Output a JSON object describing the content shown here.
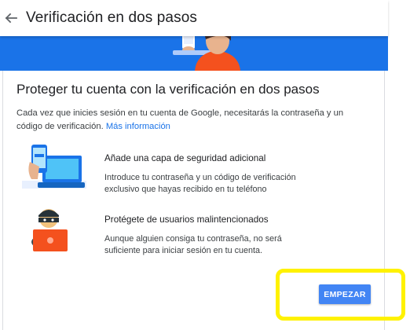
{
  "header": {
    "back_icon": "arrow-left-icon",
    "title": "Verificación en dos pasos"
  },
  "banner": {
    "illustration": "person-at-laptop-illustration",
    "colors": {
      "background": "#1a73e8",
      "skin": "#e8b38e",
      "hair": "#3e2723",
      "shirt": "#f4511e"
    }
  },
  "main": {
    "heading": "Proteger tu cuenta con la verificación en dos pasos",
    "description": "Cada vez que inicies sesión en tu cuenta de Google, necesitarás la contraseña y un código de verificación.",
    "more_info_link": "Más información"
  },
  "features": [
    {
      "icon": "phone-laptop-security-icon",
      "title": "Añade una capa de seguridad adicional",
      "text": "Introduce tu contraseña y un código de verificación exclusivo que hayas recibido en tu teléfono"
    },
    {
      "icon": "masked-intruder-icon",
      "title": "Protégete de usuarios malintencionados",
      "text": "Aunque alguien consiga tu contraseña, no será suficiente para iniciar sesión en tu cuenta."
    }
  ],
  "actions": {
    "start_label": "EMPEZAR"
  },
  "colors": {
    "accent": "#1a73e8",
    "button": "#4285f4",
    "highlight": "#fff200"
  }
}
